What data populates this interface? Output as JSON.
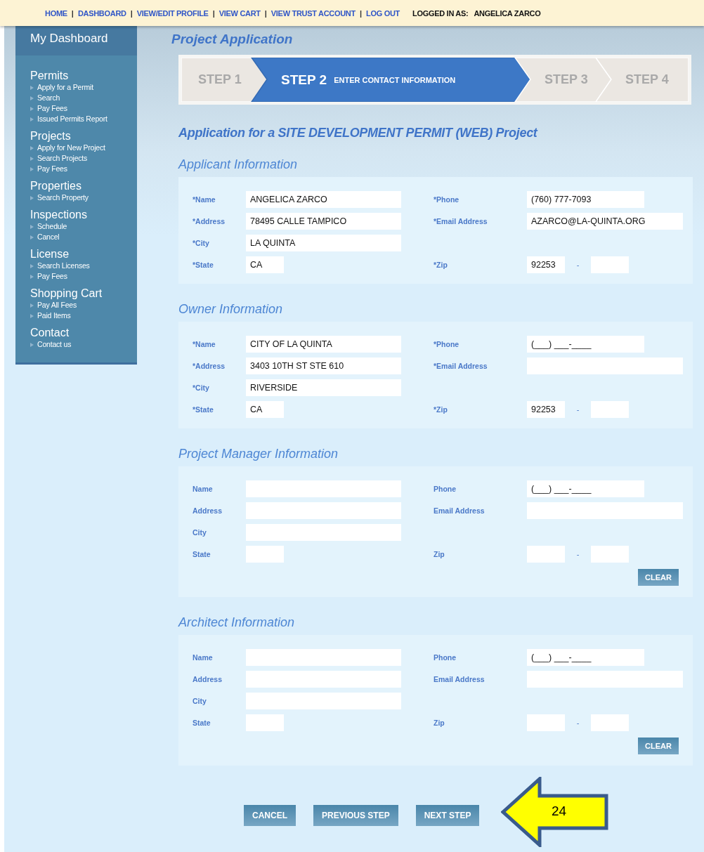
{
  "top_nav": {
    "links": [
      "HOME",
      "DASHBOARD",
      "VIEW/EDIT PROFILE",
      "VIEW CART",
      "VIEW TRUST ACCOUNT",
      "LOG OUT"
    ],
    "separator": "|",
    "logged_in_label": "LOGGED IN AS:",
    "user": "ANGELICA ZARCO"
  },
  "sidebar": {
    "title": "My Dashboard",
    "groups": [
      {
        "heading": "Permits",
        "items": [
          "Apply for a Permit",
          "Search",
          "Pay Fees",
          "Issued Permits Report"
        ]
      },
      {
        "heading": "Projects",
        "items": [
          "Apply for New Project",
          "Search Projects",
          "Pay Fees"
        ]
      },
      {
        "heading": "Properties",
        "items": [
          "Search Property"
        ]
      },
      {
        "heading": "Inspections",
        "items": [
          "Schedule",
          "Cancel"
        ]
      },
      {
        "heading": "License",
        "items": [
          "Search Licenses",
          "Pay Fees"
        ]
      },
      {
        "heading": "Shopping Cart",
        "items": [
          "Pay All Fees",
          "Paid Items"
        ]
      },
      {
        "heading": "Contact",
        "items": [
          "Contact us"
        ]
      }
    ]
  },
  "page_title": "Project Application",
  "steps": [
    {
      "label": "STEP 1",
      "selected": false
    },
    {
      "label": "STEP 2",
      "caption": "ENTER CONTACT INFORMATION",
      "selected": true
    },
    {
      "label": "STEP 3",
      "selected": false
    },
    {
      "label": "STEP 4",
      "selected": false
    }
  ],
  "application_title": "Application for a SITE DEVELOPMENT PERMIT (WEB) Project",
  "sections": [
    {
      "title": "Applicant Information",
      "rows": [
        {
          "left": {
            "label": "*Name",
            "kind": "long",
            "value": "ANGELICA ZARCO"
          },
          "right": {
            "label": "*Phone",
            "kind": "phone",
            "value": "(760) 777-7093"
          }
        },
        {
          "left": {
            "label": "*Address",
            "kind": "long",
            "value": "78495 CALLE TAMPICO"
          },
          "right": {
            "label": "*Email Address",
            "kind": "email",
            "value": "AZARCO@LA-QUINTA.ORG"
          }
        },
        {
          "left": {
            "label": "*City",
            "kind": "long",
            "value": "LA QUINTA"
          }
        },
        {
          "left": {
            "label": "*State",
            "kind": "short",
            "value": "CA"
          },
          "right": {
            "label": "*Zip",
            "kind": "zip",
            "value": "92253",
            "separator": "-"
          }
        }
      ]
    },
    {
      "title": "Owner Information",
      "rows": [
        {
          "left": {
            "label": "*Name",
            "kind": "long",
            "value": "CITY OF LA QUINTA"
          },
          "right": {
            "label": "*Phone",
            "kind": "phone",
            "placeholder": "(___) ___-____"
          }
        },
        {
          "left": {
            "label": "*Address",
            "kind": "long",
            "value": "3403 10TH ST STE 610"
          },
          "right": {
            "label": "*Email Address",
            "kind": "email"
          }
        },
        {
          "left": {
            "label": "*City",
            "kind": "long",
            "value": "RIVERSIDE"
          }
        },
        {
          "left": {
            "label": "*State",
            "kind": "short",
            "value": "CA"
          },
          "right": {
            "label": "*Zip",
            "kind": "zip",
            "value": "92253",
            "separator": "-"
          }
        }
      ]
    },
    {
      "title": "Project Manager Information",
      "clear_button": "CLEAR",
      "rows": [
        {
          "left": {
            "label": "Name",
            "kind": "long"
          },
          "right": {
            "label": "Phone",
            "kind": "phone",
            "placeholder": "(___) ___-____"
          }
        },
        {
          "left": {
            "label": "Address",
            "kind": "long"
          },
          "right": {
            "label": "Email Address",
            "kind": "email"
          }
        },
        {
          "left": {
            "label": "City",
            "kind": "long"
          }
        },
        {
          "left": {
            "label": "State",
            "kind": "short"
          },
          "right": {
            "label": "Zip",
            "kind": "zip",
            "separator": "-"
          }
        }
      ]
    },
    {
      "title": "Architect Information",
      "clear_button": "CLEAR",
      "rows": [
        {
          "left": {
            "label": "Name",
            "kind": "long"
          },
          "right": {
            "label": "Phone",
            "kind": "phone",
            "placeholder": "(___) ___-____"
          }
        },
        {
          "left": {
            "label": "Address",
            "kind": "long"
          },
          "right": {
            "label": "Email Address",
            "kind": "email"
          }
        },
        {
          "left": {
            "label": "City",
            "kind": "long"
          }
        },
        {
          "left": {
            "label": "State",
            "kind": "short"
          },
          "right": {
            "label": "Zip",
            "kind": "zip",
            "separator": "-"
          }
        }
      ]
    }
  ],
  "actions": [
    "CANCEL",
    "PREVIOUS STEP",
    "NEXT STEP"
  ],
  "callout": {
    "label": "24"
  }
}
